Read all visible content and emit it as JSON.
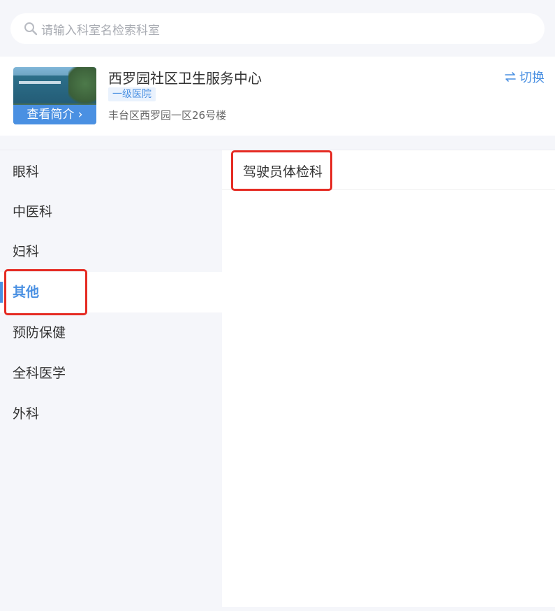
{
  "search": {
    "placeholder": "请输入科室名检索科室"
  },
  "hospital": {
    "name": "西罗园社区卫生服务中心",
    "level": "一级医院",
    "address": "丰台区西罗园一区26号楼",
    "intro_button": "查看简介 ›",
    "switch_label": "切换"
  },
  "sidebar": {
    "items": [
      {
        "label": "眼科"
      },
      {
        "label": "中医科"
      },
      {
        "label": "妇科"
      },
      {
        "label": "其他"
      },
      {
        "label": "预防保健"
      },
      {
        "label": "全科医学"
      },
      {
        "label": "外科"
      }
    ],
    "active_index": 3
  },
  "departments": {
    "items": [
      {
        "label": "驾驶员体检科"
      }
    ]
  },
  "colors": {
    "accent": "#4a90e2",
    "highlight": "#e52b23",
    "background": "#f5f6fa"
  }
}
